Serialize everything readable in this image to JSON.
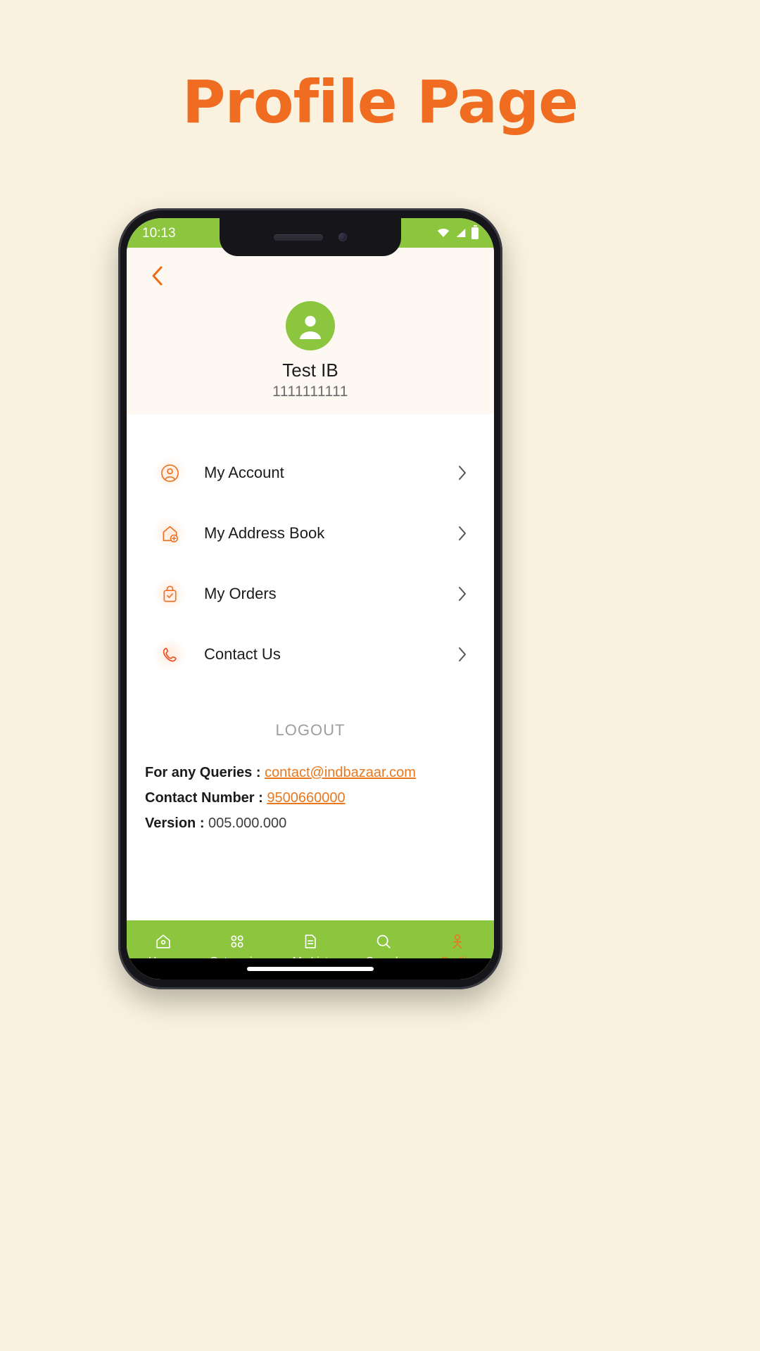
{
  "headline": "Profile Page",
  "accent_color": "#ef6c20",
  "brand_green": "#8cc63f",
  "statusbar": {
    "time": "10:13",
    "icons": [
      "wifi-icon",
      "signal-icon",
      "battery-icon"
    ]
  },
  "header": {
    "back_icon": "chevron-left-icon",
    "avatar_icon": "user-avatar-icon",
    "user_name": "Test IB",
    "user_phone": "1111111111"
  },
  "menu": {
    "items": [
      {
        "label": "My Account",
        "icon": "user-circle-icon",
        "chevron": "chevron-right-icon"
      },
      {
        "label": "My Address Book",
        "icon": "home-add-icon",
        "chevron": "chevron-right-icon"
      },
      {
        "label": "My Orders",
        "icon": "shopping-bag-check-icon",
        "chevron": "chevron-right-icon"
      },
      {
        "label": "Contact Us",
        "icon": "phone-icon",
        "chevron": "chevron-right-icon"
      }
    ]
  },
  "logout_label": "LOGOUT",
  "footer": {
    "queries_label": "For any Queries : ",
    "queries_value": "contact@indbazaar.com",
    "contact_label": "Contact Number : ",
    "contact_value": "9500660000",
    "version_label": "Version : ",
    "version_value": "005.000.000"
  },
  "bottomnav": {
    "items": [
      {
        "label": "Home",
        "icon": "home-icon",
        "active": false
      },
      {
        "label": "Categories",
        "icon": "grid-icon",
        "active": false
      },
      {
        "label": "My List",
        "icon": "document-icon",
        "active": false
      },
      {
        "label": "Search",
        "icon": "search-icon",
        "active": false
      },
      {
        "label": "Profile",
        "icon": "person-icon",
        "active": true
      }
    ]
  }
}
